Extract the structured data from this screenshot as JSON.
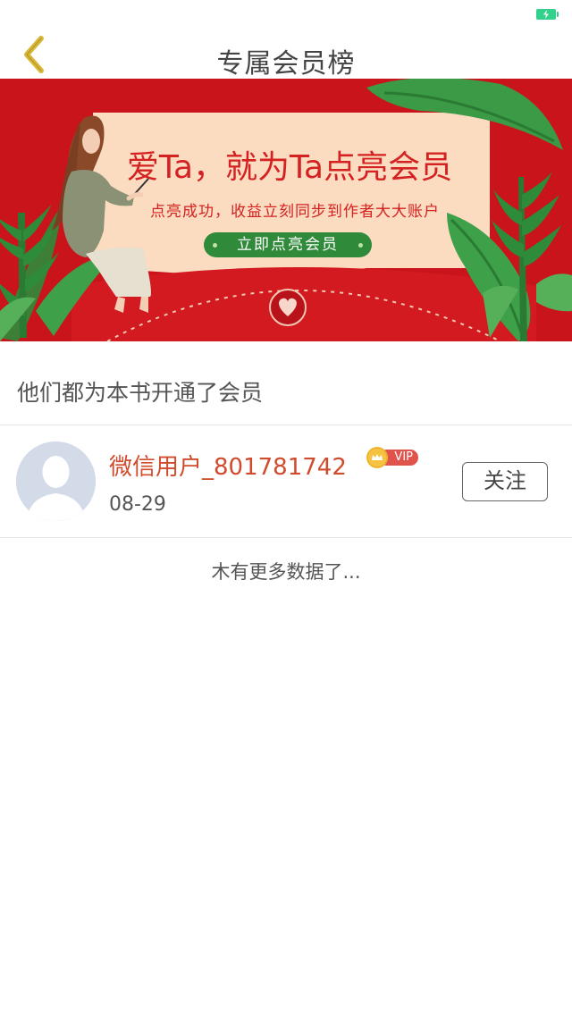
{
  "status_bar": {
    "battery_icon": "battery-charging-icon",
    "battery_color": "#33d18c"
  },
  "nav": {
    "title": "专属会员榜",
    "back_icon": "chevron-left-icon",
    "back_color": "#d9b83a"
  },
  "banner": {
    "headline": "爱Ta，就为Ta点亮会员",
    "subtitle": "点亮成功，收益立刻同步到作者大大账户",
    "cta_label": "立即点亮会员",
    "background_color": "#c9141b",
    "card_color": "#fbdcc0",
    "accent_color": "#2f8a3a"
  },
  "section": {
    "title": "他们都为本书开通了会员"
  },
  "members": [
    {
      "name": "微信用户_801781742",
      "vip_label": "VIP",
      "date": "08-29",
      "follow_label": "关注",
      "avatar_icon": "default-avatar-icon"
    }
  ],
  "list_footer": {
    "text": "木有更多数据了..."
  }
}
